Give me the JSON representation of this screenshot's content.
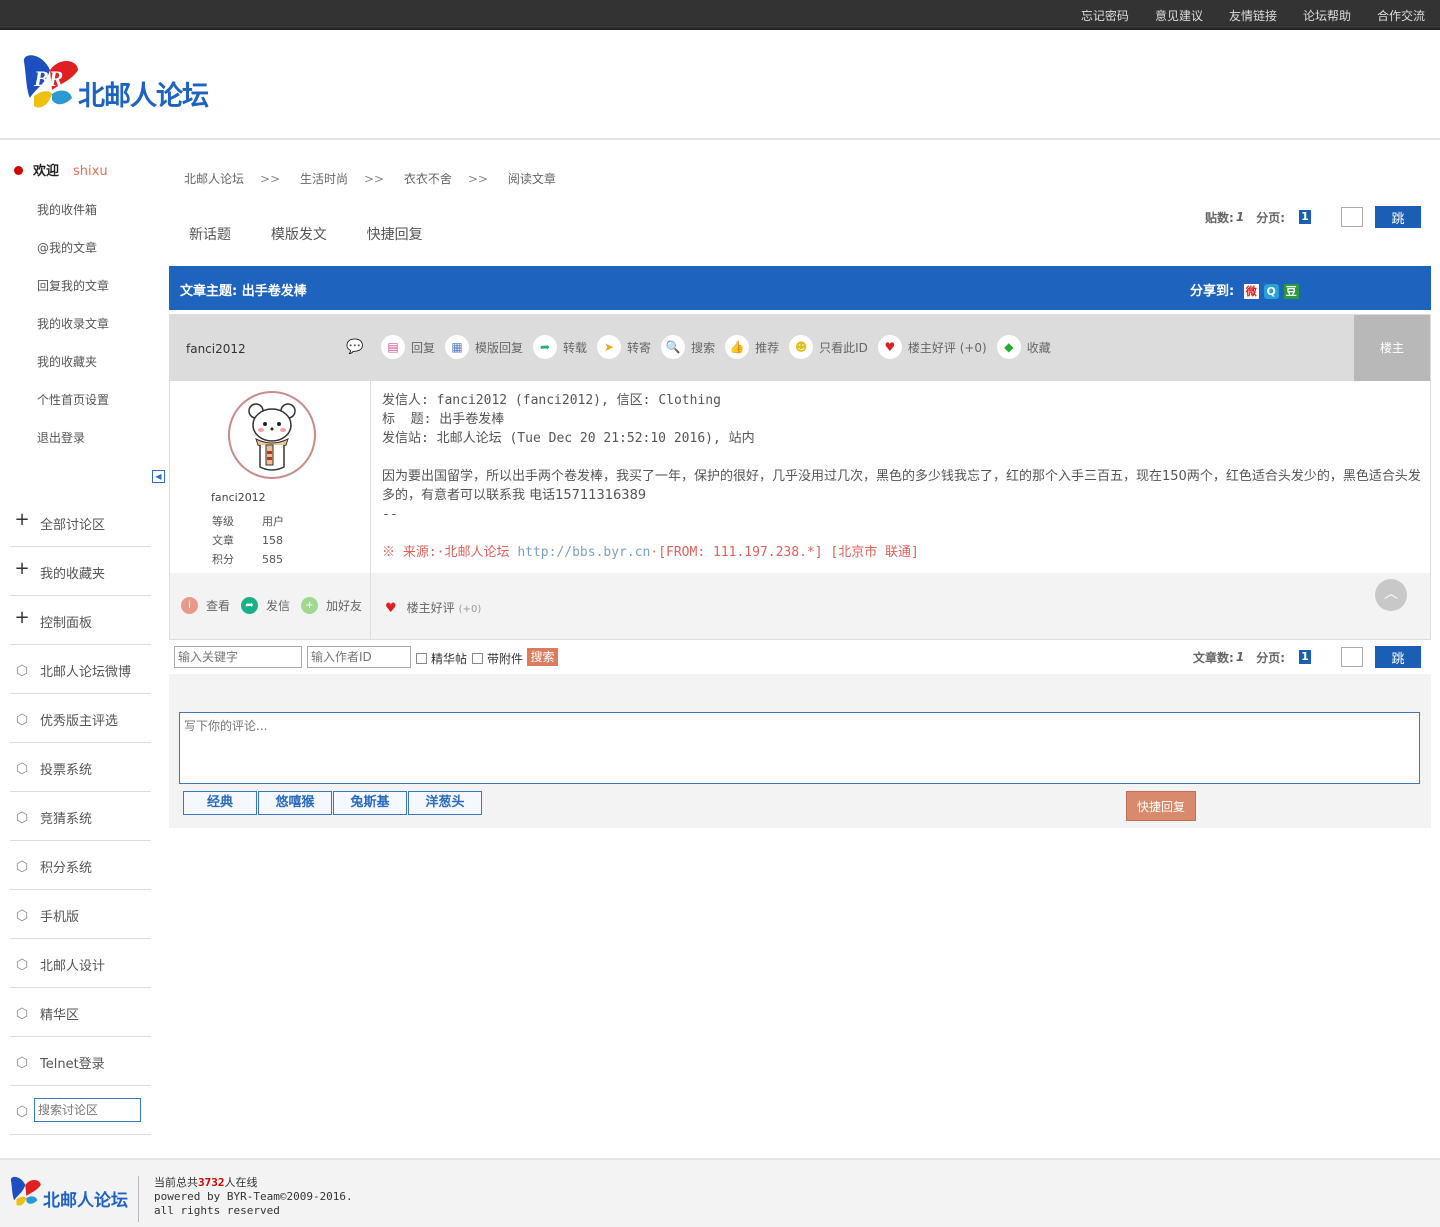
{
  "topbar": {
    "links": [
      "忘记密码",
      "意见建议",
      "友情链接",
      "论坛帮助",
      "合作交流"
    ]
  },
  "logo": {
    "text": "北邮人论坛"
  },
  "user": {
    "welcome": "欢迎",
    "username": "shixu"
  },
  "user_menu": [
    "我的收件箱",
    "@我的文章",
    "回复我的文章",
    "我的收录文章",
    "我的收藏夹",
    "个性首页设置",
    "退出登录"
  ],
  "nav": [
    {
      "label": "全部讨论区",
      "icon": "plus-icon"
    },
    {
      "label": "我的收藏夹",
      "icon": "plus-icon"
    },
    {
      "label": "控制面板",
      "icon": "plus-icon"
    },
    {
      "label": "北邮人论坛微博",
      "icon": "box-icon"
    },
    {
      "label": "优秀版主评选",
      "icon": "box-icon"
    },
    {
      "label": "投票系统",
      "icon": "box-icon"
    },
    {
      "label": "竞猜系统",
      "icon": "box-icon"
    },
    {
      "label": "积分系统",
      "icon": "box-icon"
    },
    {
      "label": "手机版",
      "icon": "box-icon"
    },
    {
      "label": "北邮人设计",
      "icon": "box-icon"
    },
    {
      "label": "精华区",
      "icon": "box-icon"
    },
    {
      "label": "Telnet登录",
      "icon": "box-icon"
    }
  ],
  "nav_search_placeholder": "搜索讨论区",
  "breadcrumb": [
    "北邮人论坛",
    "生活时尚",
    "衣衣不舍",
    "阅读文章"
  ],
  "breadcrumb_sep": ">>",
  "tabs": [
    "新话题",
    "模版发文",
    "快捷回复"
  ],
  "pager_top": {
    "count_label": "贴数:",
    "count": "1",
    "page_label": "分页:",
    "page": "1",
    "go": "跳"
  },
  "title": {
    "label": "文章主题:",
    "subject": "出手卷发棒",
    "share_label": "分享到:"
  },
  "post": {
    "author": "fanci2012",
    "floor": "楼主",
    "actions": [
      {
        "label": "回复",
        "icon": "reply-icon",
        "color": "#d94f8a"
      },
      {
        "label": "模版回复",
        "icon": "template-icon",
        "color": "#5a7ec8"
      },
      {
        "label": "转载",
        "icon": "forward-icon",
        "color": "#1ab08a"
      },
      {
        "label": "转寄",
        "icon": "send-icon",
        "color": "#e0b020"
      },
      {
        "label": "搜索",
        "icon": "search-icon",
        "color": "#2a6ac0"
      },
      {
        "label": "推荐",
        "icon": "thumb-icon",
        "color": "#d94f8a"
      },
      {
        "label": "只看此ID",
        "icon": "user-icon",
        "color": "#e0c020"
      },
      {
        "label": "楼主好评 (+0)",
        "icon": "heart-icon",
        "color": "#e02020"
      },
      {
        "label": "收藏",
        "icon": "cube-icon",
        "color": "#20b030"
      }
    ],
    "side_name": "fanci2012",
    "stats": [
      {
        "k": "等级",
        "v": "用户"
      },
      {
        "k": "文章",
        "v": "158"
      },
      {
        "k": "积分",
        "v": "585"
      }
    ],
    "head_lines": [
      "发信人: fanci2012 (fanci2012), 信区: Clothing",
      "标  题: 出手卷发棒",
      "发信站: 北邮人论坛 (Tue Dec 20 21:52:10 2016), 站内"
    ],
    "body": "因为要出国留学，所以出手两个卷发棒，我买了一年，保护的很好，几乎没用过几次，黑色的多少钱我忘了，红的那个入手三百五，现在150两个，红色适合头发少的，黑色适合头发多的，有意者可以联系我 电话15711316389",
    "sig": "--",
    "source_prefix": "※ 来源:·北邮人论坛 ",
    "source_link": "http://bbs.byr.cn",
    "source_suffix": "·[FROM: 111.197.238.*] [北京市 联通]",
    "foot_actions": [
      "查看",
      "发信",
      "加好友"
    ],
    "foot_like": "楼主好评",
    "foot_like_count": "(+0)"
  },
  "search": {
    "keyword_ph": "输入关键字",
    "author_ph": "输入作者ID",
    "cb1": "精华帖",
    "cb2": "带附件",
    "btn": "搜索"
  },
  "pager_bottom": {
    "count_label": "文章数:",
    "count": "1",
    "page_label": "分页:",
    "page": "1",
    "go": "跳"
  },
  "reply": {
    "placeholder": "写下你的评论...",
    "emotions": [
      "经典",
      "悠嘻猴",
      "兔斯基",
      "洋葱头"
    ],
    "submit": "快捷回复"
  },
  "footer": {
    "online_prefix": "当前总共",
    "online_count": "3732",
    "online_suffix": "人在线",
    "powered": "powered by BYR-Team©2009-2016.",
    "rights": "all rights reserved"
  }
}
